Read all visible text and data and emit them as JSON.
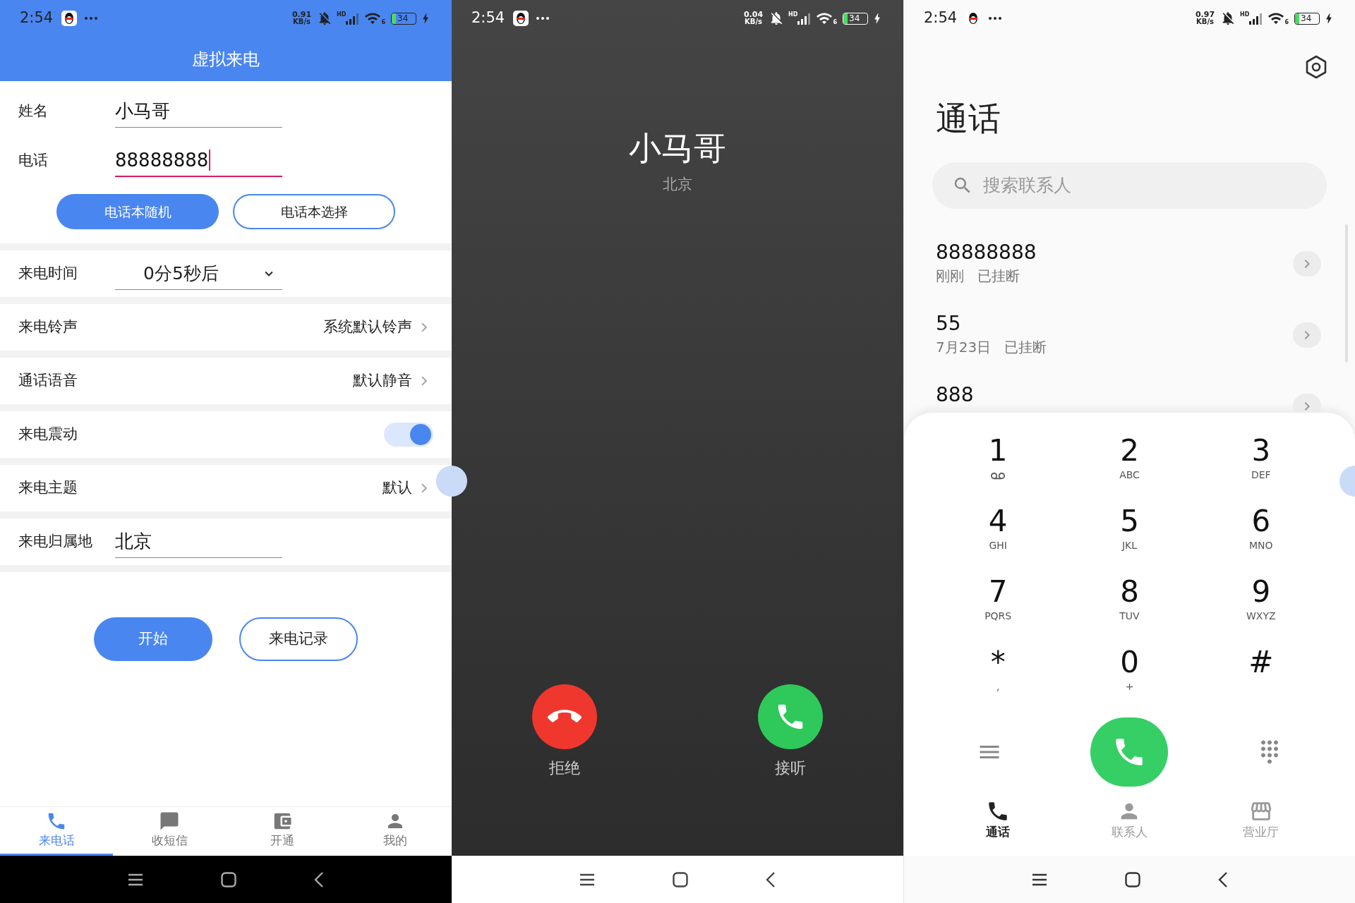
{
  "setup_screen": {
    "status_bar": {
      "time": "2:54",
      "speed": "0.91",
      "speed_unit": "KB/s",
      "network": "HD",
      "wifi_band": "6",
      "battery": "34"
    },
    "title": "虚拟来电",
    "fields": [
      {
        "label": "姓名",
        "value": "小马哥",
        "focused": false
      },
      {
        "label": "电话",
        "value": "88888888",
        "focused": true
      }
    ],
    "phonebook_buttons": [
      {
        "label": "电话本随机",
        "primary": true
      },
      {
        "label": "电话本选择",
        "primary": false
      }
    ],
    "settings": [
      {
        "kind": "dropdown",
        "label": "来电时间",
        "value": "0分5秒后"
      },
      {
        "kind": "link",
        "label": "来电铃声",
        "value": "系统默认铃声"
      },
      {
        "kind": "link",
        "label": "通话语音",
        "value": "默认静音"
      },
      {
        "kind": "toggle",
        "label": "来电震动",
        "on": true
      },
      {
        "kind": "link",
        "label": "来电主题",
        "value": "默认"
      },
      {
        "kind": "input",
        "label": "来电归属地",
        "value": "北京"
      }
    ],
    "actions": [
      {
        "label": "开始",
        "primary": true
      },
      {
        "label": "来电记录",
        "primary": false
      }
    ],
    "tabs": [
      {
        "label": "来电话",
        "selected": true
      },
      {
        "label": "收短信",
        "selected": false
      },
      {
        "label": "开通",
        "selected": false
      },
      {
        "label": "我的",
        "selected": false
      }
    ]
  },
  "incoming_call_screen": {
    "status_bar": {
      "time": "2:54",
      "speed": "0.04",
      "speed_unit": "KB/s",
      "network": "HD",
      "wifi_band": "6",
      "battery": "34"
    },
    "caller_name": "小马哥",
    "location": "北京",
    "buttons": [
      {
        "kind": "decline",
        "label": "拒绝"
      },
      {
        "kind": "answer",
        "label": "接听"
      }
    ]
  },
  "dialer_screen": {
    "status_bar": {
      "time": "2:54",
      "speed": "0.97",
      "speed_unit": "KB/s",
      "network": "HD",
      "wifi_band": "6",
      "battery": "34"
    },
    "title": "通话",
    "search": {
      "placeholder": "搜索联系人"
    },
    "call_log": [
      {
        "number": "88888888",
        "time": "刚刚",
        "status": "已挂断"
      },
      {
        "number": "55",
        "time": "7月23日",
        "status": "已挂断"
      },
      {
        "number": "888"
      }
    ],
    "keys": [
      {
        "main": "1"
      },
      {
        "main": "2",
        "sub": "ABC"
      },
      {
        "main": "3",
        "sub": "DEF"
      },
      {
        "main": "4",
        "sub": "GHI"
      },
      {
        "main": "5",
        "sub": "JKL"
      },
      {
        "main": "6",
        "sub": "MNO"
      },
      {
        "main": "7",
        "sub": "PQRS"
      },
      {
        "main": "8",
        "sub": "TUV"
      },
      {
        "main": "9",
        "sub": "WXYZ"
      },
      {
        "main": "*",
        "sub": ","
      },
      {
        "main": "0",
        "sub": "+"
      },
      {
        "main": "#"
      }
    ],
    "tabs": [
      {
        "label": "通话",
        "selected": true
      },
      {
        "label": "联系人",
        "selected": false
      },
      {
        "label": "营业厅",
        "selected": false
      }
    ]
  }
}
